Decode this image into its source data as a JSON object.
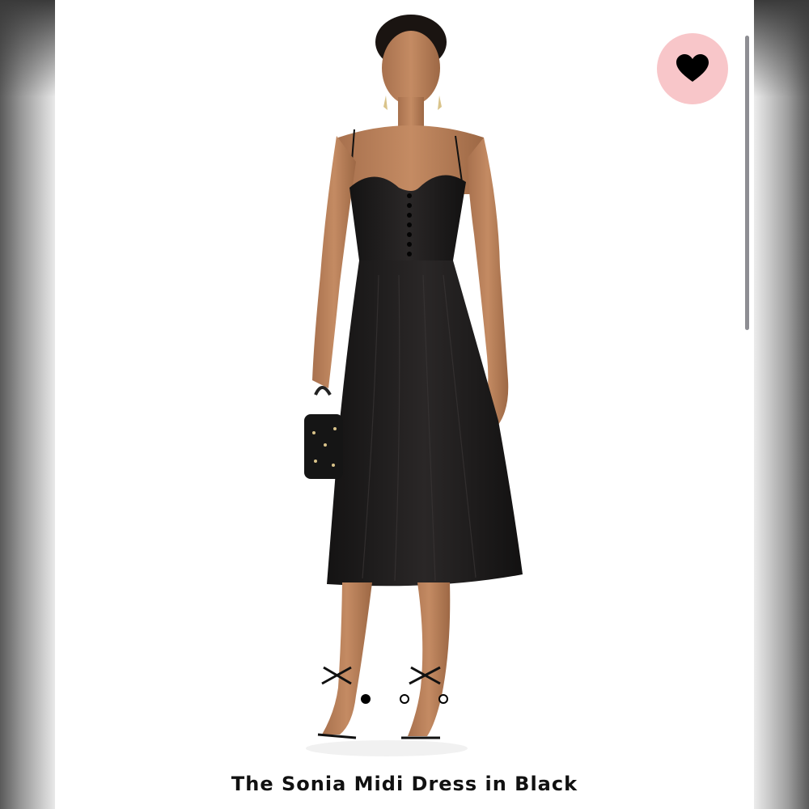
{
  "product": {
    "title": "The Sonia Midi Dress in Black",
    "image_description_icon": "model-in-black-dress-photo"
  },
  "favorite": {
    "icon": "heart-icon",
    "bg_color": "#f8c6c9",
    "icon_color": "#000000"
  },
  "carousel": {
    "total": 3,
    "active_index": 0
  }
}
